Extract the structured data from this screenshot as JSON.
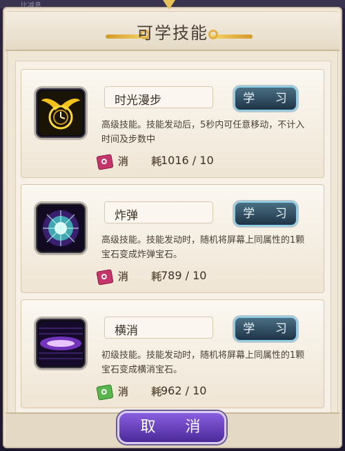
{
  "top_bar": {
    "text": "比减息"
  },
  "dialog": {
    "title": "可学技能",
    "cancel_label": "取 消"
  },
  "skills": [
    {
      "name": "时光漫步",
      "learn_label": "学 习",
      "description": "高级技能。技能发动后，5秒内可任意移动，不计入时间及步数中",
      "cost_label": "消 耗",
      "cost_value": "1016 / 10",
      "book_color": "red",
      "icon": "winged-clock-icon"
    },
    {
      "name": "炸弹",
      "learn_label": "学 习",
      "description": "高级技能。技能发动时，随机将屏幕上同属性的1颗宝石变成炸弹宝石。",
      "cost_label": "消 耗",
      "cost_value": "789 / 10",
      "book_color": "red",
      "icon": "bomb-burst-icon"
    },
    {
      "name": "横消",
      "learn_label": "学 习",
      "description": "初级技能。技能发动时，随机将屏幕上同属性的1颗宝石变成横消宝石。",
      "cost_label": "消 耗",
      "cost_value": "962 / 10",
      "book_color": "green",
      "icon": "horizontal-clear-icon"
    }
  ],
  "colors": {
    "accent_gold": "#e3b045",
    "learn_button": "#2c4a5e",
    "cancel_button": "#6a3fc2"
  }
}
